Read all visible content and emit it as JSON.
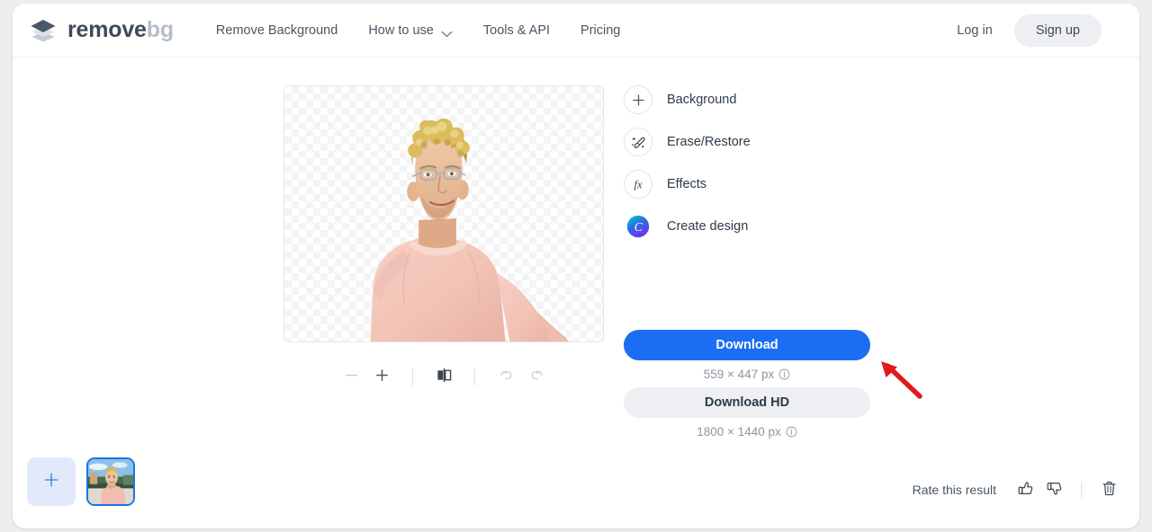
{
  "brand": {
    "name_primary": "remove",
    "name_secondary": "bg",
    "logo_icon": "layers-icon"
  },
  "nav": {
    "items": [
      {
        "label": "Remove Background",
        "icon": null
      },
      {
        "label": "How to use",
        "icon": "chevron-down-icon"
      },
      {
        "label": "Tools & API",
        "icon": null
      },
      {
        "label": "Pricing",
        "icon": null
      }
    ],
    "login_label": "Log in",
    "signup_label": "Sign up"
  },
  "tools": {
    "items": [
      {
        "label": "Background",
        "icon": "plus-icon"
      },
      {
        "label": "Erase/Restore",
        "icon": "magic-brush-icon"
      },
      {
        "label": "Effects",
        "icon": "fx-icon"
      },
      {
        "label": "Create design",
        "icon": "canva-icon"
      }
    ]
  },
  "download": {
    "primary_label": "Download",
    "primary_size": "559 × 447 px",
    "hd_label": "Download HD",
    "hd_size": "1800 × 1440 px",
    "info_icon": "info-icon"
  },
  "canvas_toolbar": {
    "zoom_out": "zoom-out-icon",
    "zoom_in": "zoom-in-icon",
    "compare": "compare-split-icon",
    "undo": "undo-icon",
    "redo": "redo-icon"
  },
  "thumbnails": {
    "add_label": "+",
    "add_icon": "plus-icon",
    "selected_index": 1
  },
  "footer": {
    "rate_label": "Rate this result",
    "thumbs_up_icon": "thumbs-up-icon",
    "thumbs_down_icon": "thumbs-down-icon",
    "delete_icon": "trash-icon"
  },
  "annotation": {
    "arrow_icon": "red-arrow-icon",
    "color": "#e01b1b"
  },
  "colors": {
    "primary_button": "#1b6ef3",
    "secondary_button": "#eef0f3",
    "page_background": "#eceef0",
    "card_background": "#ffffff",
    "selection_border": "#1a73e8"
  }
}
